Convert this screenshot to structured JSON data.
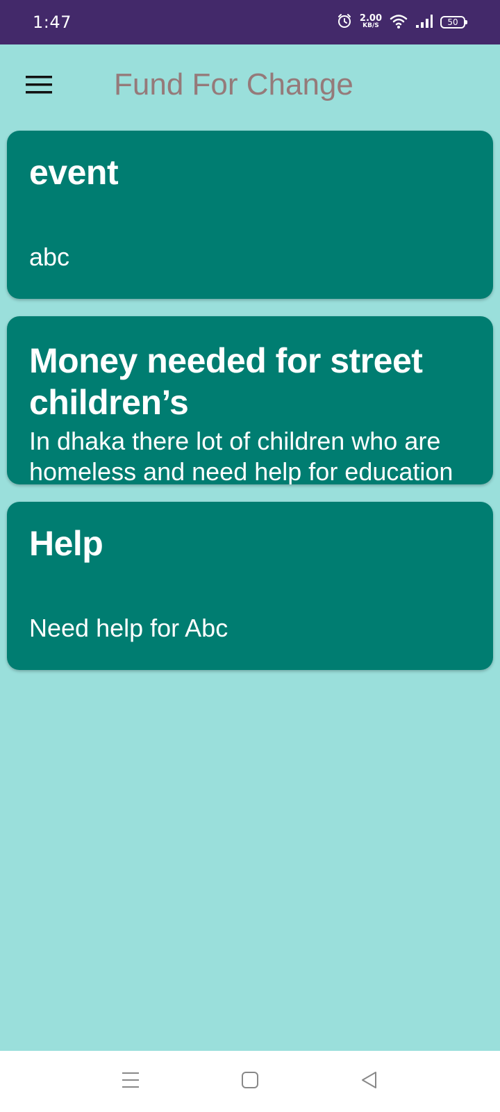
{
  "status_bar": {
    "time": "1:47",
    "net_speed_value": "2.00",
    "net_speed_unit": "KB/S",
    "battery": "50",
    "icons": [
      "alarm-icon",
      "wifi-icon",
      "signal-icon",
      "battery-icon"
    ]
  },
  "app_bar": {
    "title": "Fund For Change",
    "menu_icon": "hamburger-menu-icon"
  },
  "cards": [
    {
      "title": "event",
      "description": "abc"
    },
    {
      "title": "Money needed for street children’s",
      "description": "In dhaka there lot of children who are homeless and need help for education"
    },
    {
      "title": "Help",
      "description": "Need help for Abc"
    }
  ],
  "nav_bar": {
    "icons": [
      "recent-apps-icon",
      "home-icon",
      "back-icon"
    ]
  },
  "colors": {
    "status_bar": "#43296A",
    "background": "#9ADFDB",
    "card": "#007D71",
    "title_text": "#957A7A",
    "nav_bar": "#FFFFFF"
  }
}
